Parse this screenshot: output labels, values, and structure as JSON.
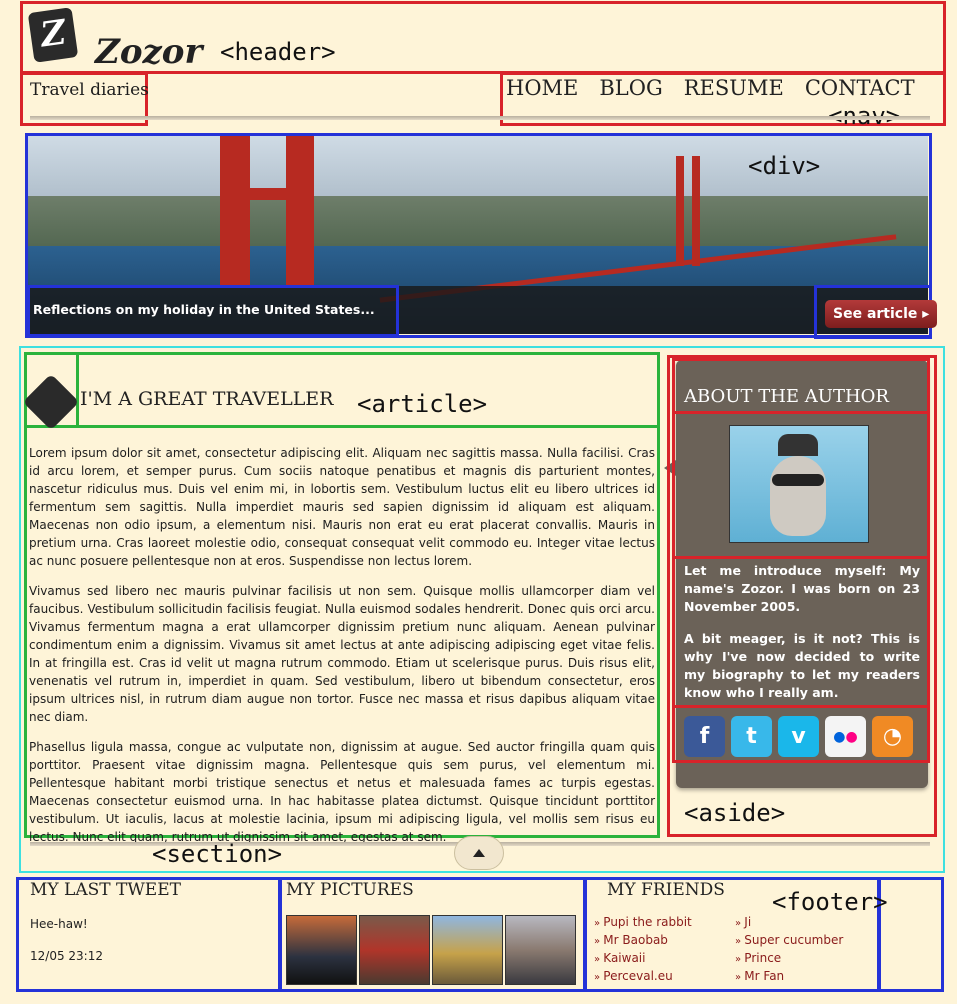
{
  "header": {
    "brand": "Zozor",
    "tag": "<header>"
  },
  "subtitle": "Travel diaries",
  "nav": {
    "items": [
      "HOME",
      "BLOG",
      "RESUME",
      "CONTACT"
    ],
    "tag": "<nav>"
  },
  "banner": {
    "tag": "<div>",
    "caption": "Reflections on my holiday in the United States...",
    "button": "See article ▸"
  },
  "article": {
    "tag": "<article>",
    "title": "I'M A GREAT TRAVELLER",
    "paragraphs": [
      "Lorem ipsum dolor sit amet, consectetur adipiscing elit. Aliquam nec sagittis massa. Nulla facilisi. Cras id arcu lorem, et semper purus. Cum sociis natoque penatibus et magnis dis parturient montes, nascetur ridiculus mus. Duis vel enim mi, in lobortis sem. Vestibulum luctus elit eu libero ultrices id fermentum sem sagittis. Nulla imperdiet mauris sed sapien dignissim id aliquam est aliquam. Maecenas non odio ipsum, a elementum nisi. Mauris non erat eu erat placerat convallis. Mauris in pretium urna. Cras laoreet molestie odio, consequat consequat velit commodo eu. Integer vitae lectus ac nunc posuere pellentesque non at eros. Suspendisse non lectus lorem.",
      "Vivamus sed libero nec mauris pulvinar facilisis ut non sem. Quisque mollis ullamcorper diam vel faucibus. Vestibulum sollicitudin facilisis feugiat. Nulla euismod sodales hendrerit. Donec quis orci arcu. Vivamus fermentum magna a erat ullamcorper dignissim pretium nunc aliquam. Aenean pulvinar condimentum enim a dignissim. Vivamus sit amet lectus at ante adipiscing adipiscing eget vitae felis. In at fringilla est. Cras id velit ut magna rutrum commodo. Etiam ut scelerisque purus. Duis risus elit, venenatis vel rutrum in, imperdiet in quam. Sed vestibulum, libero ut bibendum consectetur, eros ipsum ultrices nisl, in rutrum diam augue non tortor. Fusce nec massa et risus dapibus aliquam vitae nec diam.",
      "Phasellus ligula massa, congue ac vulputate non, dignissim at augue. Sed auctor fringilla quam quis porttitor. Praesent vitae dignissim magna. Pellentesque quis sem purus, vel elementum mi. Pellentesque habitant morbi tristique senectus et netus et malesuada fames ac turpis egestas. Maecenas consectetur euismod urna. In hac habitasse platea dictumst. Quisque tincidunt porttitor vestibulum. Ut iaculis, lacus at molestie lacinia, ipsum mi adipiscing ligula, vel mollis sem risus eu lectus. Nunc elit quam, rutrum ut dignissim sit amet, egestas at sem."
    ]
  },
  "section_tag": "<section>",
  "aside": {
    "tag": "<aside>",
    "title": "ABOUT THE AUTHOR",
    "paragraphs": [
      "Let me introduce myself: My name's Zozor. I was born on 23 November 2005.",
      "A bit meager, is it not? This is why I've now decided to write my biography to let my readers know who I really am."
    ],
    "social": [
      {
        "icon": "facebook-icon",
        "glyph": "f",
        "color": "#3b5998"
      },
      {
        "icon": "twitter-icon",
        "glyph": "t",
        "color": "#38b8ea"
      },
      {
        "icon": "vimeo-icon",
        "glyph": "v",
        "color": "#1ab7ea"
      },
      {
        "icon": "flickr-icon",
        "glyph": "••",
        "color": "#f4f4f4"
      },
      {
        "icon": "rss-icon",
        "glyph": "◔",
        "color": "#f08a24"
      }
    ]
  },
  "footer": {
    "tag": "<footer>",
    "tweet_title": "MY LAST TWEET",
    "tweet_text": "Hee-haw!",
    "tweet_time": "12/05 23:12",
    "pictures_title": "MY PICTURES",
    "friends_title": "MY FRIENDS",
    "friends_left": [
      "Pupi the rabbit",
      "Mr Baobab",
      "Kaiwaii",
      "Perceval.eu"
    ],
    "friends_right": [
      "Ji",
      "Super cucumber",
      "Prince",
      "Mr Fan"
    ]
  }
}
